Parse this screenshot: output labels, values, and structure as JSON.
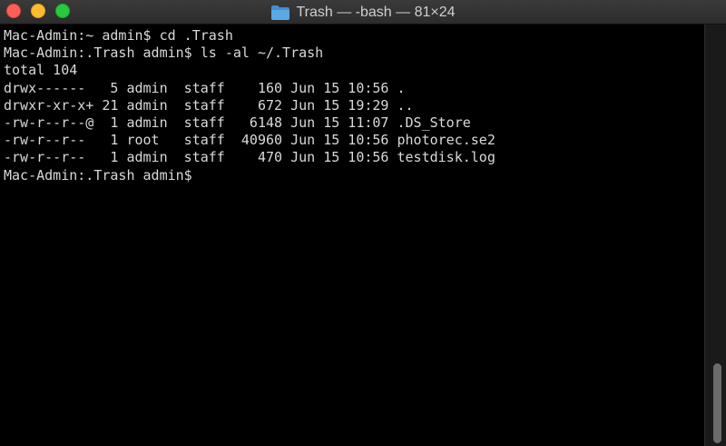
{
  "window": {
    "folder_icon": "folder-icon",
    "title": "Trash — -bash — 81×24"
  },
  "terminal": {
    "lines": [
      "Mac-Admin:~ admin$ cd .Trash",
      "Mac-Admin:.Trash admin$ ls -al ~/.Trash",
      "total 104",
      "drwx------   5 admin  staff    160 Jun 15 10:56 .",
      "drwxr-xr-x+ 21 admin  staff    672 Jun 15 19:29 ..",
      "-rw-r--r--@  1 admin  staff   6148 Jun 15 11:07 .DS_Store",
      "-rw-r--r--   1 root   staff  40960 Jun 15 10:56 photorec.se2",
      "-rw-r--r--   1 admin  staff    470 Jun 15 10:56 testdisk.log",
      "Mac-Admin:.Trash admin$ "
    ]
  },
  "colors": {
    "close": "#fe5f57",
    "minimize": "#febc2e",
    "maximize": "#28c840",
    "folder": "#5aa9e6",
    "background": "#000000",
    "text": "#d9d9d9"
  }
}
